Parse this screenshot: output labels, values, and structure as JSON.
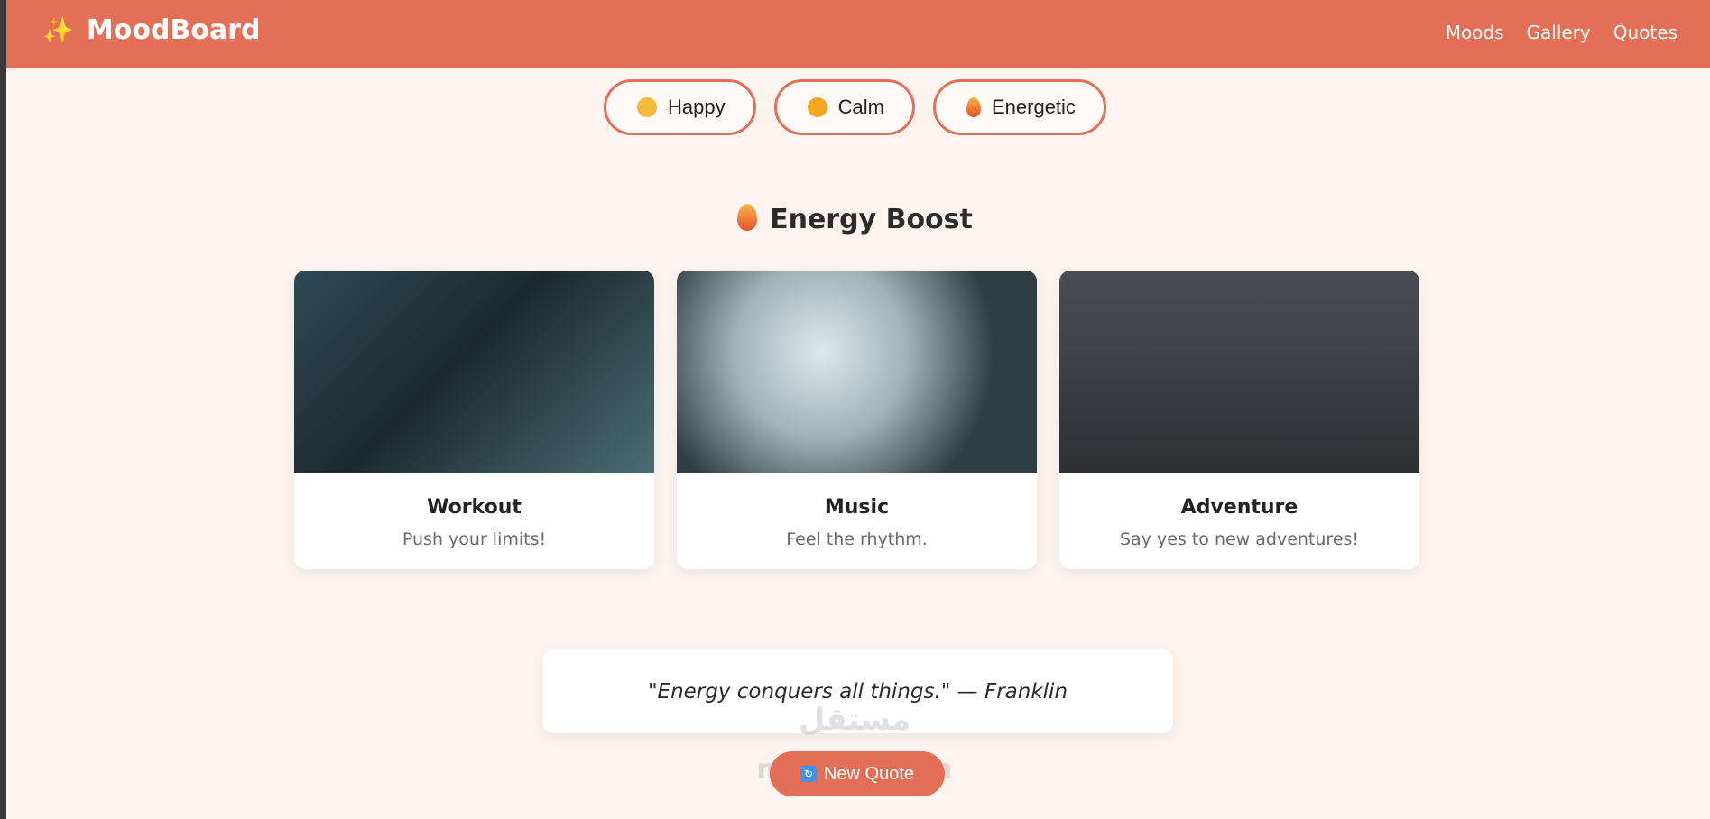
{
  "header": {
    "brand": "MoodBoard",
    "nav": [
      "Moods",
      "Gallery",
      "Quotes"
    ]
  },
  "moods": [
    {
      "label": "Happy",
      "icon": "smiling-face-icon"
    },
    {
      "label": "Calm",
      "icon": "relieved-face-icon"
    },
    {
      "label": "Energetic",
      "icon": "fire-icon"
    }
  ],
  "section": {
    "title": "Energy Boost",
    "icon": "fire-icon"
  },
  "cards": [
    {
      "title": "Workout",
      "desc": "Push your limits!"
    },
    {
      "title": "Music",
      "desc": "Feel the rhythm."
    },
    {
      "title": "Adventure",
      "desc": "Say yes to new adventures!"
    }
  ],
  "quote": {
    "text": "\"Energy conquers all things.\" — Franklin"
  },
  "new_quote_button": "New Quote",
  "watermark": {
    "text": "مستقل",
    "sub": "mostaql.com"
  },
  "colors": {
    "accent": "#e26f56",
    "background": "#fdf3ef"
  }
}
